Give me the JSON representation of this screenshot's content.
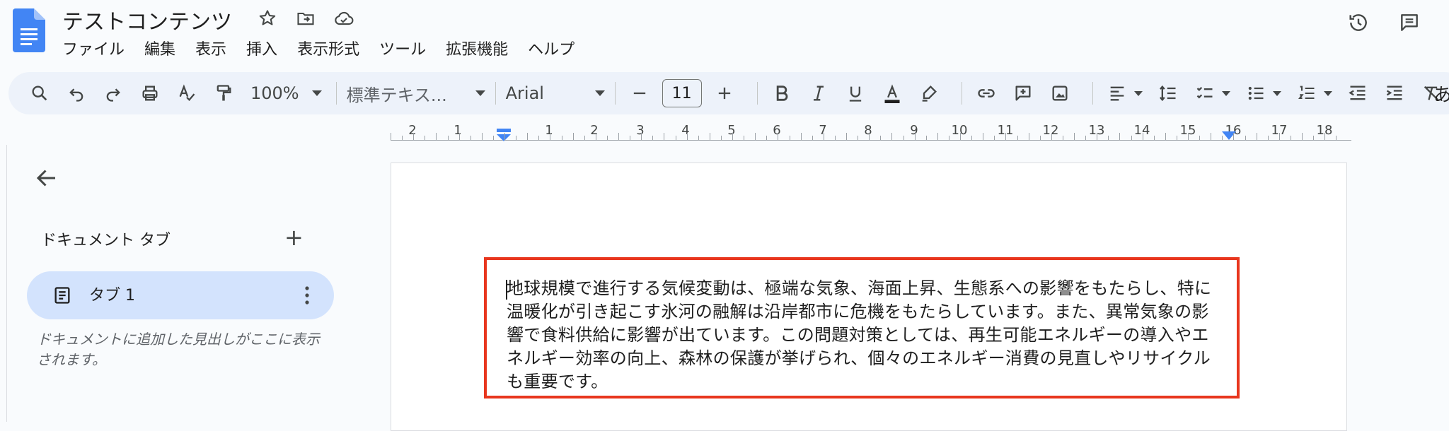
{
  "app": {
    "document_title": "テストコンテンツ",
    "brand_color": "#4285f4"
  },
  "menu": [
    "ファイル",
    "編集",
    "表示",
    "挿入",
    "表示形式",
    "ツール",
    "拡張機能",
    "ヘルプ"
  ],
  "toolbar": {
    "zoom": "100%",
    "style": "標準テキス...",
    "font": "Arial",
    "font_size": "11",
    "overflow_char": "あ"
  },
  "ruler": {
    "left_numbers": [
      "2",
      "1"
    ],
    "right_numbers": [
      "1",
      "2",
      "3",
      "4",
      "5",
      "6",
      "7",
      "8",
      "9",
      "10",
      "11",
      "12",
      "13",
      "14",
      "15",
      "16",
      "17",
      "18"
    ]
  },
  "sidebar": {
    "heading": "ドキュメント タブ",
    "add_symbol": "+",
    "tabs": [
      {
        "label": "タブ 1"
      }
    ],
    "hint": "ドキュメントに追加した見出しがここに表示されます。"
  },
  "document": {
    "body_lines": [
      "地球規模で進行する気候変動は、極端な気象、海面上昇、生態系への影響をもたらし、特に",
      "温暖化が引き起こす氷河の融解は沿岸都市に危機をもたらしています。また、異常気象の影",
      "響で食料供給に影響が出ています。この問題対策としては、再生可能エネルギーの導入やエ",
      "ネルギー効率の向上、森林の保護が挙げられ、個々のエネルギー消費の見直しやリサイクル",
      "も重要です。"
    ],
    "highlight_color": "#e8361e"
  }
}
